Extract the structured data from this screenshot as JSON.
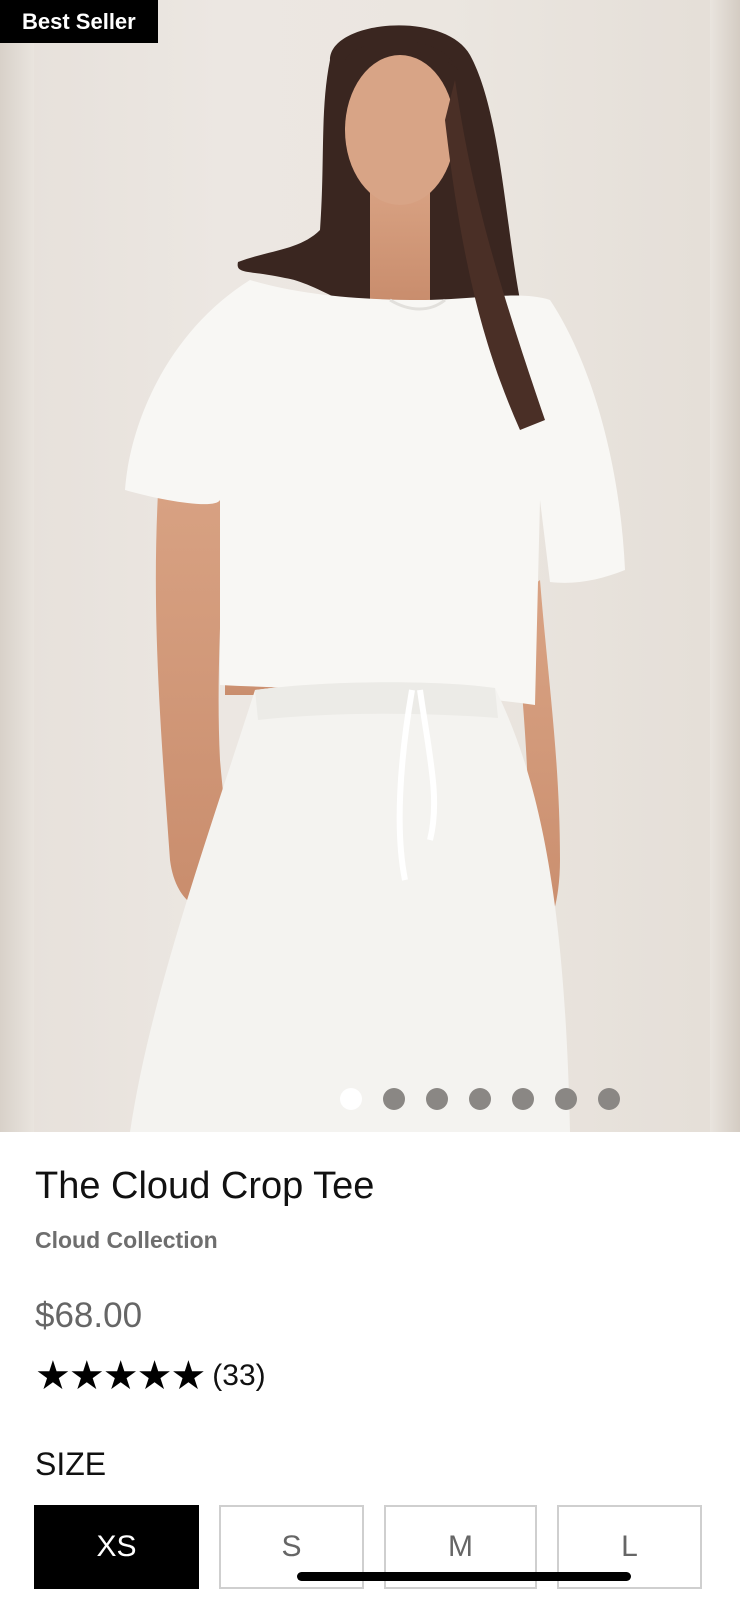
{
  "badge": "Best Seller",
  "gallery": {
    "count": 7,
    "active_index": 0
  },
  "product": {
    "title": "The Cloud Crop Tee",
    "collection": "Cloud Collection",
    "price": "$68.00",
    "rating": {
      "stars": "★★★★★",
      "value": 5,
      "count": "(33)"
    }
  },
  "size": {
    "label": "SIZE",
    "options": [
      "XS",
      "S",
      "M",
      "L"
    ],
    "selected": "XS"
  },
  "colors": {
    "accent": "#000000",
    "muted_text": "#666666",
    "border": "#cfcfcf"
  }
}
